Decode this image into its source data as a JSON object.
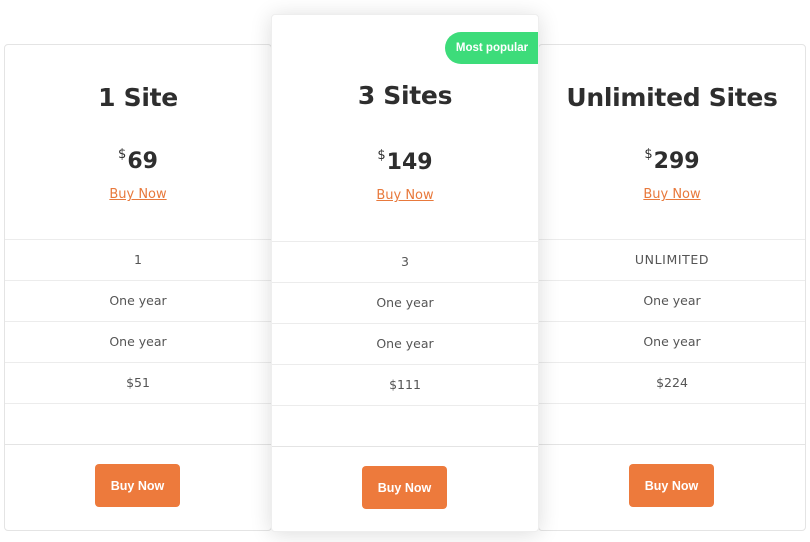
{
  "plans": [
    {
      "title": "1 Site",
      "currency": "$",
      "price": "69",
      "link_label": "Buy Now",
      "rows": [
        "1",
        "One year",
        "One year",
        "$51"
      ],
      "button_label": "Buy Now"
    },
    {
      "title": "3 Sites",
      "currency": "$",
      "price": "149",
      "link_label": "Buy Now",
      "badge": "Most popular",
      "rows": [
        "3",
        "One year",
        "One year",
        "$111"
      ],
      "button_label": "Buy Now"
    },
    {
      "title": "Unlimited Sites",
      "currency": "$",
      "price": "299",
      "link_label": "Buy Now",
      "rows": [
        "UNLIMITED",
        "One year",
        "One year",
        "$224"
      ],
      "button_label": "Buy Now"
    }
  ],
  "colors": {
    "accent": "#ed7a3c",
    "link": "#e8793c",
    "badge": "#3ddc7a",
    "border": "#e4e4e4",
    "title_text": "#2e2e2e",
    "row_text": "#555555"
  }
}
